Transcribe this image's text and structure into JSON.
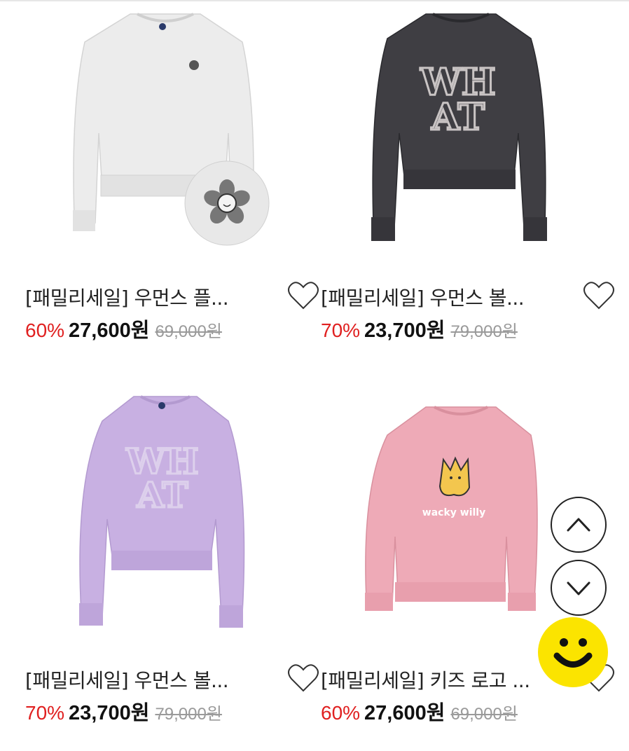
{
  "products": [
    {
      "title": "[패밀리세일] 우먼스 플...",
      "discount": "60%",
      "sale_price": "27,600원",
      "original_price": "69,000원",
      "color": "#ececec",
      "liked": false
    },
    {
      "title": "[패밀리세일] 우먼스 볼...",
      "discount": "70%",
      "sale_price": "23,700원",
      "original_price": "79,000원",
      "color": "#3f3e43",
      "liked": false
    },
    {
      "title": "[패밀리세일] 우먼스 볼...",
      "discount": "70%",
      "sale_price": "23,700원",
      "original_price": "79,000원",
      "color": "#c8b0e2",
      "liked": false
    },
    {
      "title": "[패밀리세일] 키즈 로고 ...",
      "discount": "60%",
      "sale_price": "27,600원",
      "original_price": "69,000원",
      "color": "#eeaab7",
      "liked": false
    }
  ],
  "print_text": {
    "what_top": "WH",
    "what_bottom": "AT",
    "wacky": "wacky willy"
  },
  "icons": {
    "like": "heart-outline-icon",
    "scroll_up": "chevron-up-icon",
    "scroll_down": "chevron-down-icon",
    "chatbot": "smile-chat-icon"
  },
  "colors": {
    "discount": "#e02020",
    "chatbot": "#fbe400"
  }
}
